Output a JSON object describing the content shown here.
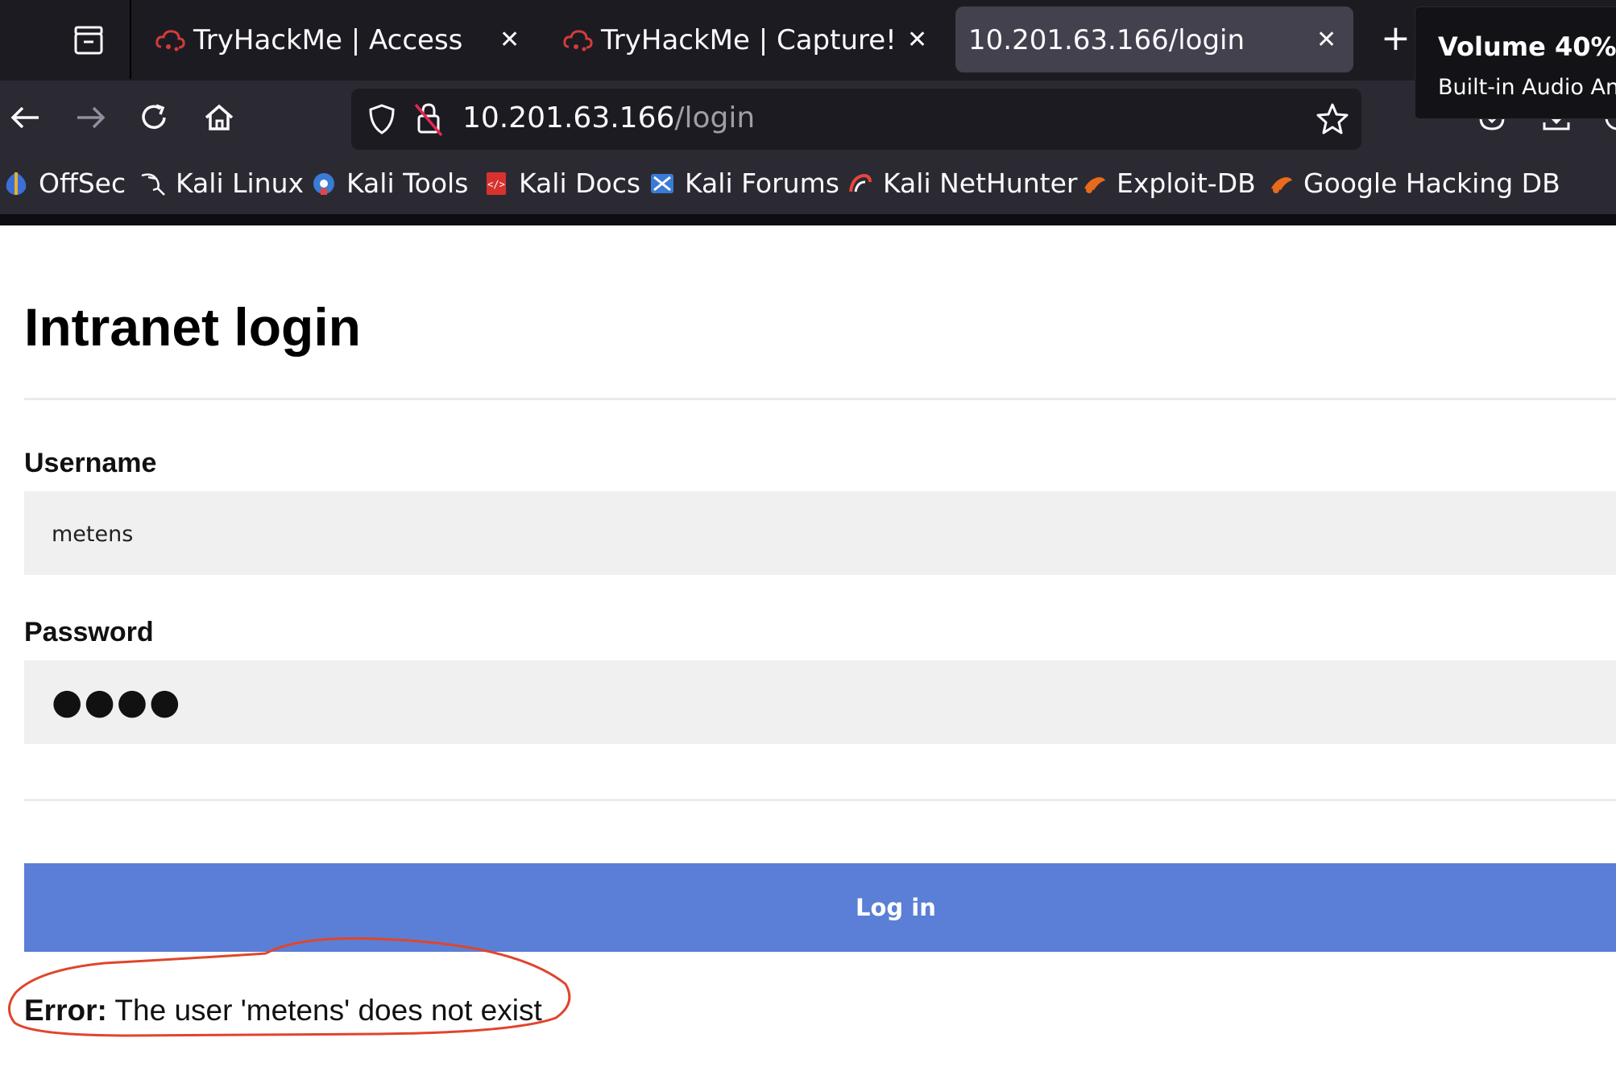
{
  "browser": {
    "tabs": [
      {
        "title": "TryHackMe | Access",
        "favicon": "tryhackme-icon",
        "active": false
      },
      {
        "title": "TryHackMe | Capture!",
        "favicon": "tryhackme-icon",
        "active": false
      },
      {
        "title": "10.201.63.166/login",
        "favicon": "",
        "active": true
      }
    ],
    "new_tab_label": "+",
    "url_host": "10.201.63.166",
    "url_path": "/login",
    "bookmarks": [
      {
        "label": "OffSec",
        "icon": "offsec-icon"
      },
      {
        "label": "Kali Linux",
        "icon": "kali-dragon-icon"
      },
      {
        "label": "Kali Tools",
        "icon": "kali-tools-icon"
      },
      {
        "label": "Kali Docs",
        "icon": "kali-docs-icon"
      },
      {
        "label": "Kali Forums",
        "icon": "kali-forums-icon"
      },
      {
        "label": "Kali NetHunter",
        "icon": "kali-nethunter-icon"
      },
      {
        "label": "Exploit-DB",
        "icon": "exploit-db-icon"
      },
      {
        "label": "Google Hacking DB",
        "icon": "ghdb-icon"
      }
    ]
  },
  "volume_osd": {
    "title": "Volume 40%",
    "subtitle": "Built-in Audio Ana"
  },
  "page": {
    "heading": "Intranet login",
    "username_label": "Username",
    "username_value": "metens",
    "password_label": "Password",
    "password_value": "●●●●",
    "login_button": "Log in",
    "error_prefix": "Error:",
    "error_message": " The user 'metens' does not exist"
  },
  "colors": {
    "login_button": "#5b7fd6",
    "annotation_circle": "#e0452b",
    "input_background": "#f0f0f0"
  }
}
